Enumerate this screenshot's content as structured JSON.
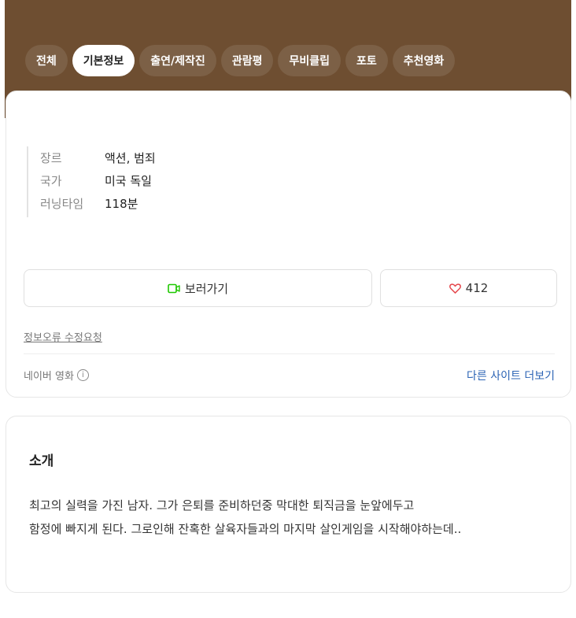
{
  "tabs": [
    {
      "label": "전체",
      "active": false
    },
    {
      "label": "기본정보",
      "active": true
    },
    {
      "label": "출연/제작진",
      "active": false
    },
    {
      "label": "관람평",
      "active": false
    },
    {
      "label": "무비클립",
      "active": false
    },
    {
      "label": "포토",
      "active": false
    },
    {
      "label": "추천영화",
      "active": false
    }
  ],
  "info": {
    "genre_label": "장르",
    "genre_value": "액션, 범죄",
    "country_label": "국가",
    "country_value": "미국 독일",
    "runtime_label": "러닝타임",
    "runtime_value": "118분"
  },
  "actions": {
    "watch_label": "보러가기",
    "like_count": "412",
    "watch_icon": "video-camera-icon",
    "like_icon": "heart-outline-icon"
  },
  "footer": {
    "edit_request": "정보오류 수정요청",
    "source": "네이버 영화",
    "info_icon": "i",
    "other_sites": "다른 사이트 더보기"
  },
  "intro": {
    "title": "소개",
    "text": "최고의 실력을 가진 남자. 그가 은퇴를 준비하던중 막대한 퇴직금을 눈앞에두고\n함정에 빠지게 된다. 그로인해 잔혹한 살육자들과의 마지막 살인게임을 시작해야하는데.."
  },
  "colors": {
    "header_brown": "#6e4e31",
    "link_blue": "#2c64b5",
    "watch_icon_green": "#1ec800",
    "like_icon_red": "#e5484d"
  }
}
